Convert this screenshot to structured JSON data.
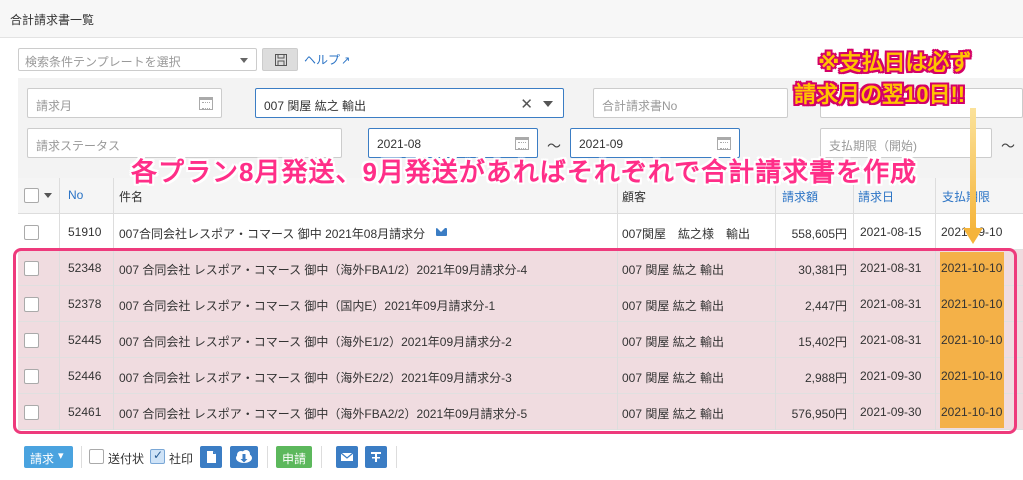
{
  "page": {
    "title": "合計請求書一覧"
  },
  "template": {
    "placeholder": "検索条件テンプレートを選択",
    "help_label": "ヘルプ",
    "ext_icon": "↗"
  },
  "filters": {
    "billing_month_ph": "請求月",
    "customer_value": "007 関屋 紘之 輸出",
    "clear_glyph": "✕",
    "invoice_no_ph": "合計請求書No",
    "status_ph": "請求ステータス",
    "date_from": "2021-08",
    "date_to": "2021-09",
    "range_sep": "～",
    "due_start_ph": "支払期限（開始)",
    "due_sep": "～"
  },
  "annotations": {
    "pink_text": "各プラン8月発送、9月発送があればそれぞれで合計請求書を作成",
    "yellow_line1": "※支払日は必ず",
    "yellow_line2": "請求月の翌10日!!"
  },
  "colors": {
    "highlight_row": "#f0dce0",
    "pink_frame": "#ee3a7c",
    "orange_col": "#f4b148",
    "link": "#2a73c5"
  },
  "table": {
    "headers": {
      "no": "No",
      "subject": "件名",
      "customer": "顧客",
      "amount": "請求額",
      "bill_date": "請求日",
      "due_date": "支払期限"
    },
    "rows": [
      {
        "no": "51910",
        "subject": "007合同会社レスポア・コマース 御中 2021年08月請求分",
        "customer": "007関屋　紘之様　輸出",
        "amount": "558,605円",
        "bill_date": "2021-08-15",
        "due_date": "2021-09-10",
        "highlight": false,
        "mail_icon": "mail-icon"
      },
      {
        "no": "52348",
        "subject": "007 合同会社 レスポア・コマース 御中（海外FBA1/2）2021年09月請求分-4",
        "customer": "007 関屋 紘之 輸出",
        "amount": "30,381円",
        "bill_date": "2021-08-31",
        "due_date": "2021-10-10",
        "highlight": true
      },
      {
        "no": "52378",
        "subject": "007 合同会社 レスポア・コマース 御中（国内E）2021年09月請求分-1",
        "customer": "007 関屋 紘之 輸出",
        "amount": "2,447円",
        "bill_date": "2021-08-31",
        "due_date": "2021-10-10",
        "highlight": true
      },
      {
        "no": "52445",
        "subject": "007 合同会社 レスポア・コマース 御中（海外E1/2）2021年09月請求分-2",
        "customer": "007 関屋 紘之 輸出",
        "amount": "15,402円",
        "bill_date": "2021-08-31",
        "due_date": "2021-10-10",
        "highlight": true
      },
      {
        "no": "52446",
        "subject": "007 合同会社 レスポア・コマース 御中（海外E2/2）2021年09月請求分-3",
        "customer": "007 関屋 紘之 輸出",
        "amount": "2,988円",
        "bill_date": "2021-09-30",
        "due_date": "2021-10-10",
        "highlight": true
      },
      {
        "no": "52461",
        "subject": "007 合同会社 レスポア・コマース 御中（海外FBA2/2）2021年09月請求分-5",
        "customer": "007 関屋 紘之 輸出",
        "amount": "576,950円",
        "bill_date": "2021-09-30",
        "due_date": "2021-10-10",
        "highlight": true
      }
    ]
  },
  "toolbar": {
    "bill_label": "請求",
    "bill_caret": "▾",
    "waybill_label": "送付状",
    "seal_label": "社印",
    "apply_label": "申請"
  }
}
